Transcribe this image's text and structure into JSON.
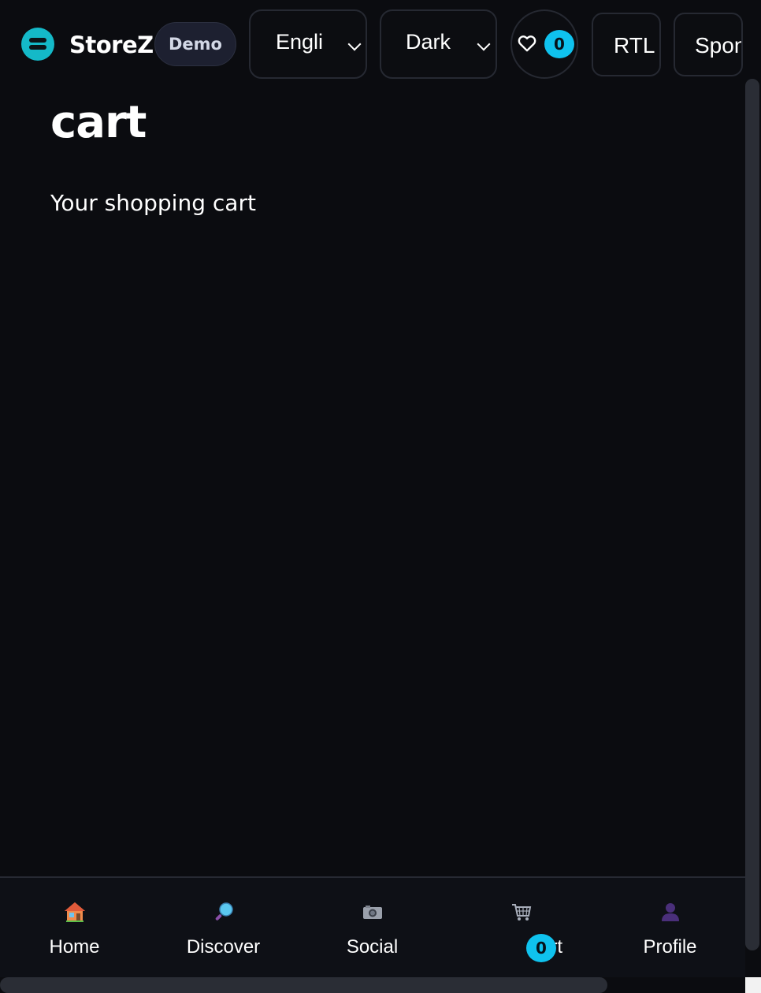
{
  "header": {
    "brand": "StoreZ",
    "badge": "Demo",
    "language_select": {
      "value": "Engli"
    },
    "theme_select": {
      "value": "Dark"
    },
    "favorites": {
      "icon": "heart-icon",
      "count": "0"
    },
    "rtl_label": "RTL",
    "sponsor_label": "Spon"
  },
  "main": {
    "title": "cart",
    "subtitle": "Your shopping cart"
  },
  "bottom_nav": {
    "items": [
      {
        "label": "Home",
        "icon": "house-icon"
      },
      {
        "label": "Discover",
        "icon": "magnifier-icon"
      },
      {
        "label": "Social",
        "icon": "camera-icon"
      },
      {
        "label": "Cart",
        "icon": "cart-icon",
        "count": "0"
      },
      {
        "label": "Profile",
        "icon": "person-icon"
      }
    ]
  },
  "colors": {
    "background": "#0b0c10",
    "accent": "#0fc2ee",
    "logo": "#14b9c8",
    "border": "#262932"
  }
}
